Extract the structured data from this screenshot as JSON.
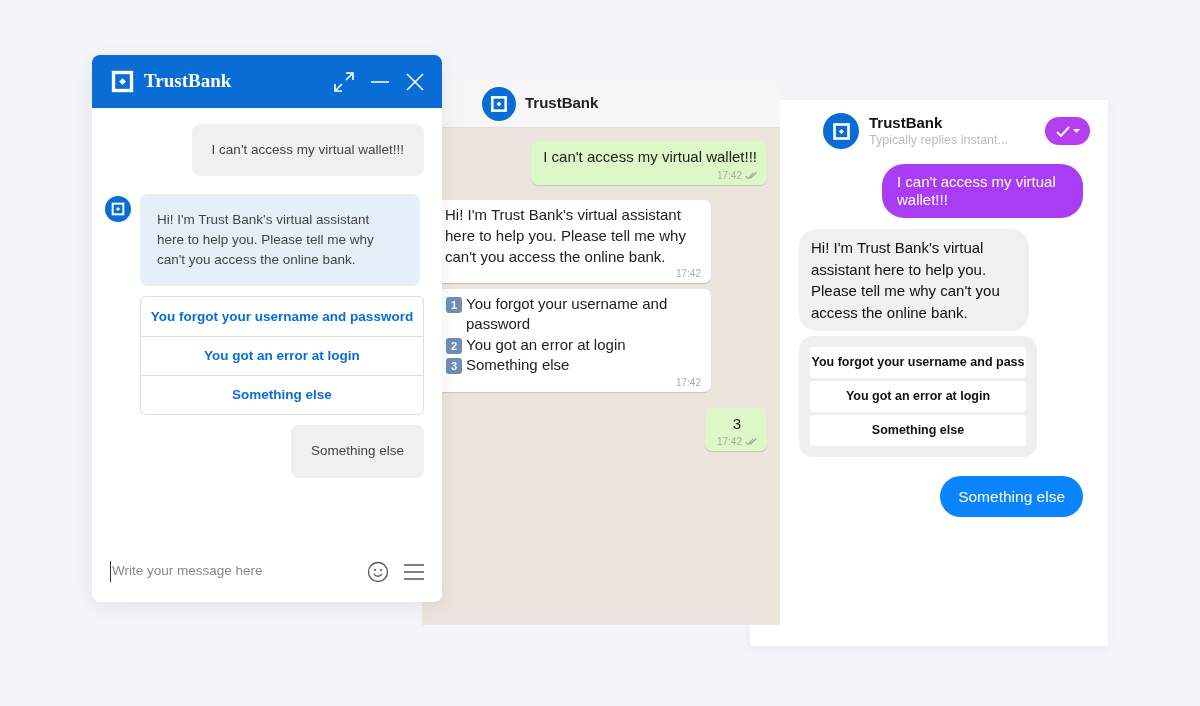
{
  "web_widget": {
    "title": "TrustBank",
    "input_placeholder": "Write your message here",
    "messages": [
      {
        "kind": "user",
        "text": "I can't access my virtual wallet!!!"
      },
      {
        "kind": "bot",
        "text": "Hi! I'm Trust Bank's virtual assistant here to help you. Please tell me why can't you access the online bank."
      },
      {
        "kind": "options",
        "options": [
          "You forgot your username and password",
          "You got an error at login",
          "Something else"
        ]
      },
      {
        "kind": "user",
        "text": "Something else"
      }
    ]
  },
  "whatsapp": {
    "title": "TrustBank",
    "messages": [
      {
        "kind": "sent",
        "text": "I can't access my virtual wallet!!!",
        "time": "17:42"
      },
      {
        "kind": "received",
        "text": "Hi! I'm Trust Bank's virtual assistant here to help you. Please tell me why can't you access the online bank.",
        "time": "17:42"
      },
      {
        "kind": "list",
        "items": [
          {
            "key": "1",
            "text": "You forgot your username and password"
          },
          {
            "key": "2",
            "text": "You got an error at login"
          },
          {
            "key": "3",
            "text": "Something else"
          }
        ],
        "time": "17:42"
      },
      {
        "kind": "sent",
        "text": "3",
        "time": "17:42"
      }
    ]
  },
  "messenger": {
    "title": "TrustBank",
    "subtitle": "Typically replies instant...",
    "messages": [
      {
        "kind": "user",
        "text": "I can't access my virtual wallet!!!"
      },
      {
        "kind": "bot",
        "text": "Hi! I'm Trust Bank's virtual assistant here to help you. Please tell me why can't you access the online bank."
      },
      {
        "kind": "options",
        "options": [
          "You forgot your username and pass",
          "You got an error at login",
          "Something else"
        ]
      },
      {
        "kind": "reply",
        "text": "Something else"
      }
    ]
  }
}
